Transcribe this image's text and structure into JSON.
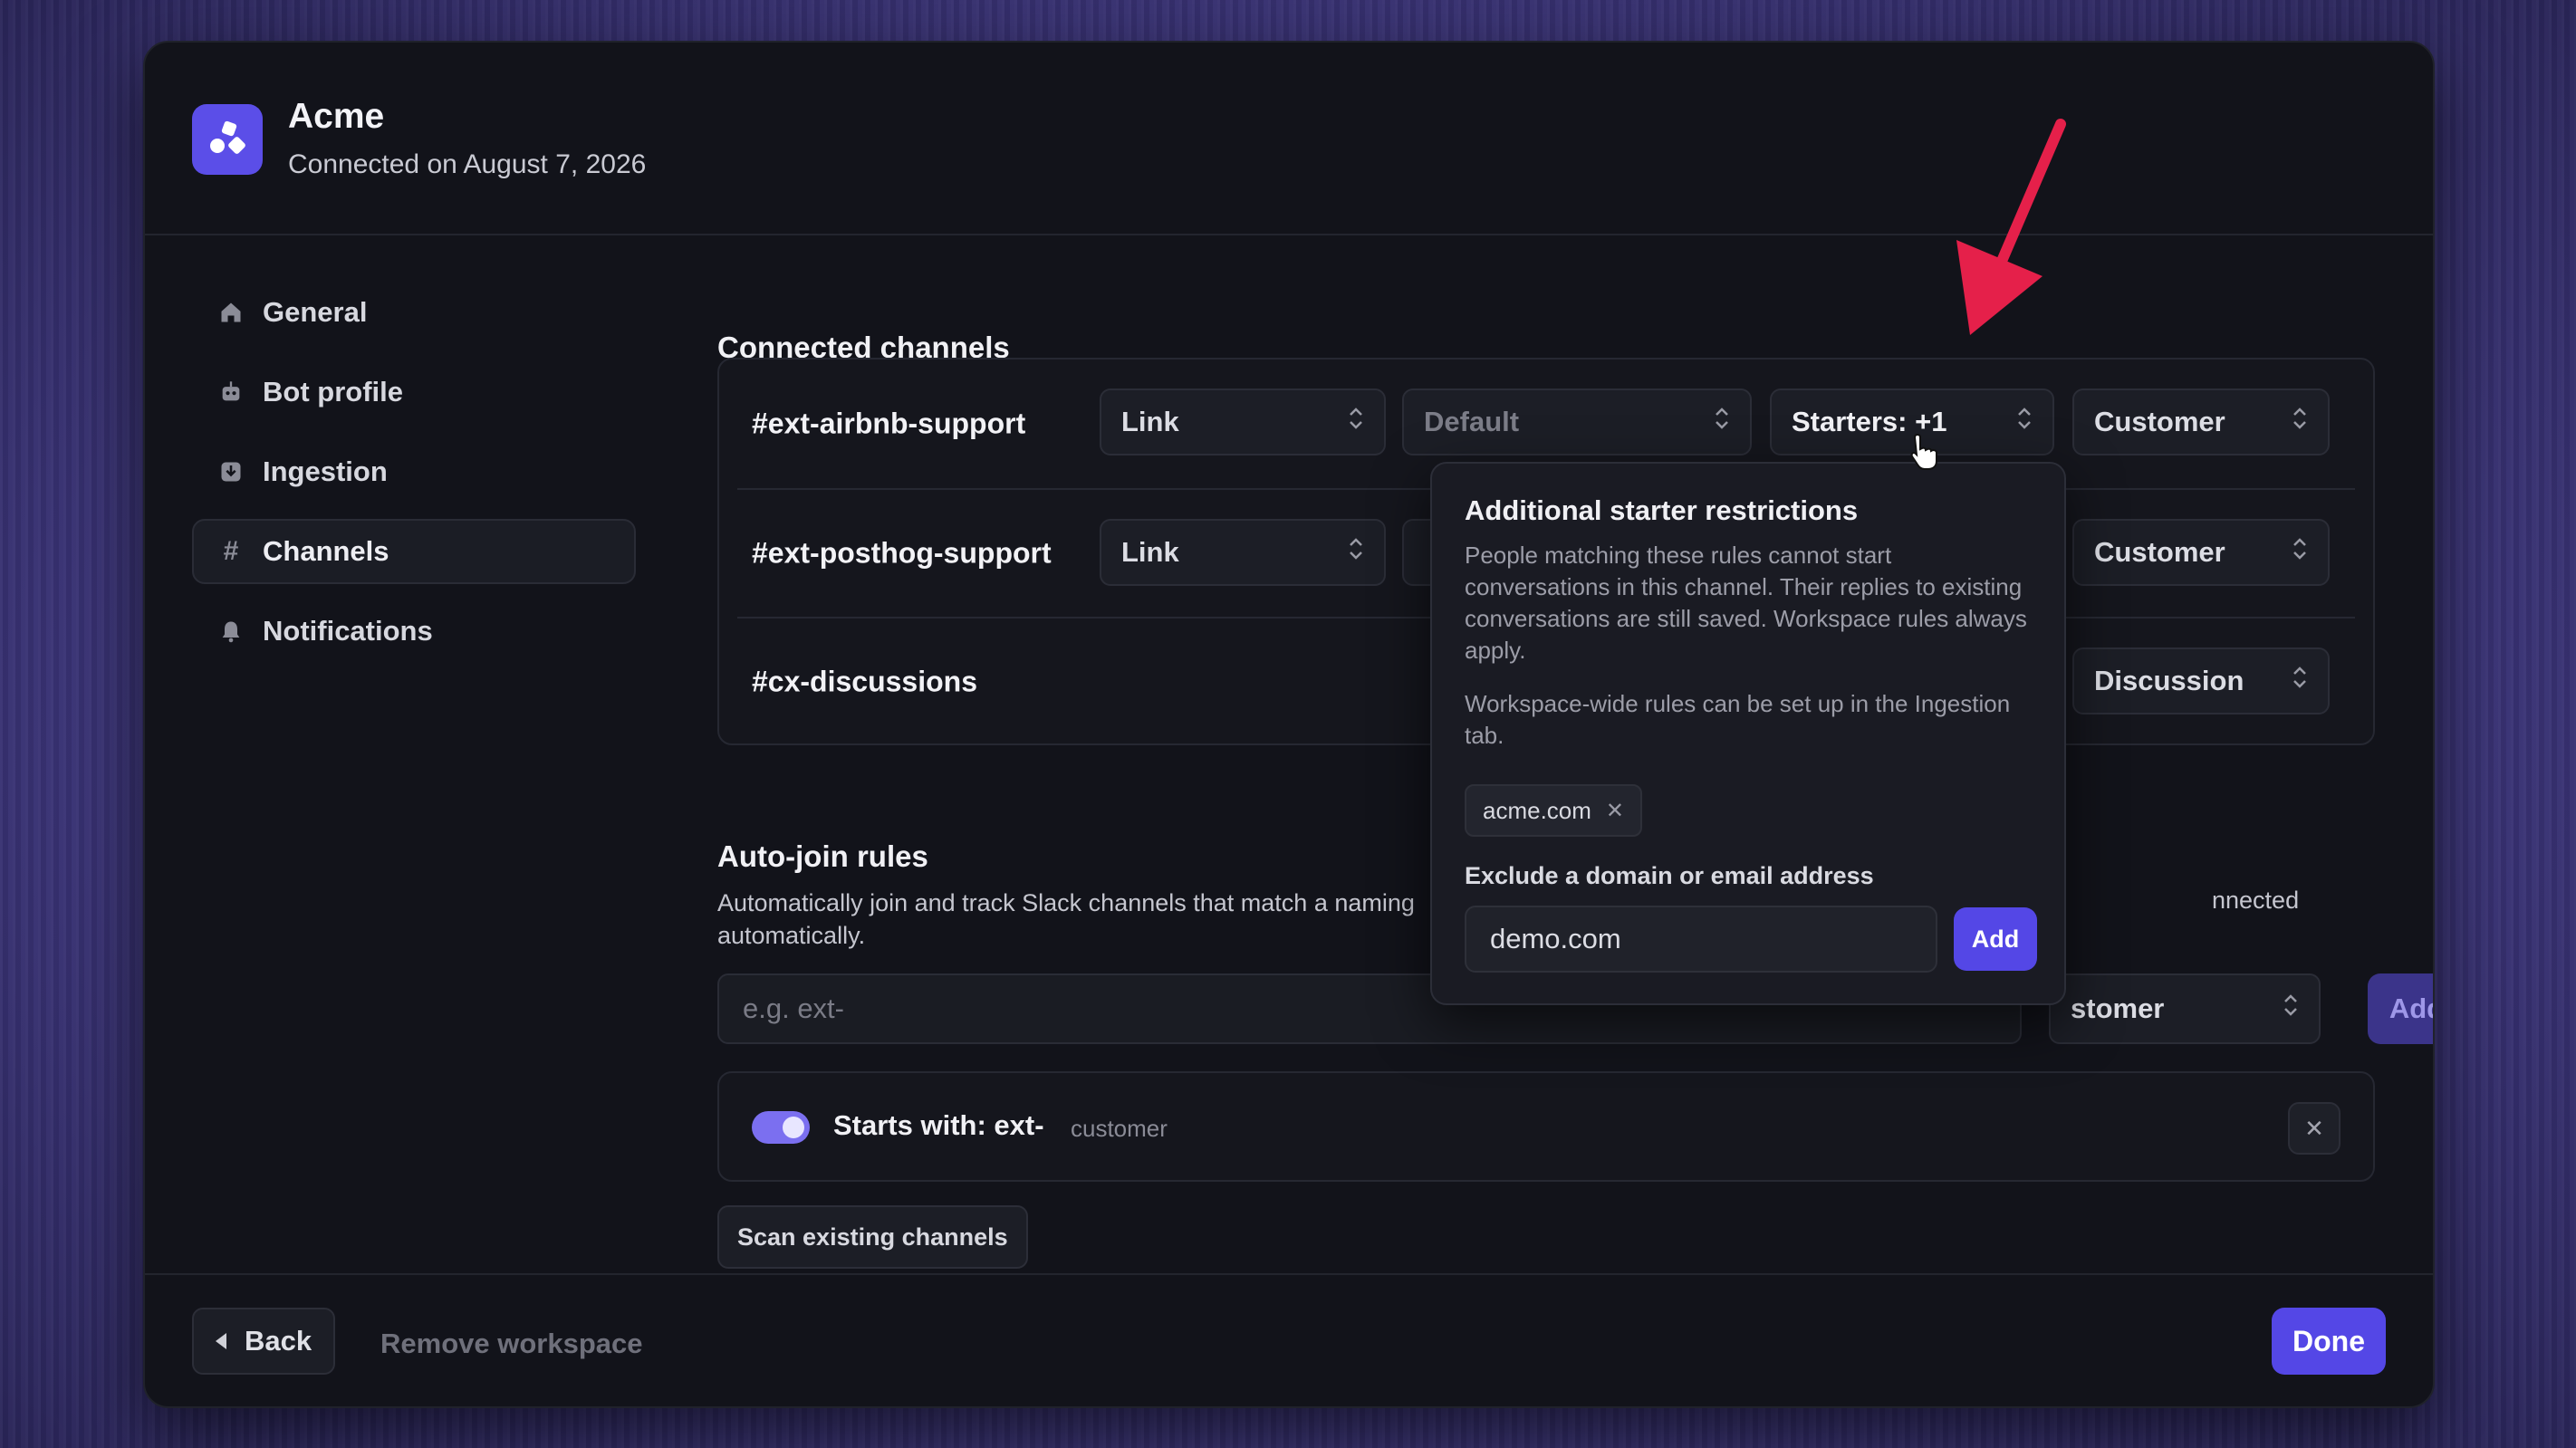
{
  "workspace": {
    "name": "Acme",
    "connected": "Connected on August 7, 2026",
    "logo_icon": "shapes-icon"
  },
  "sidebar": {
    "items": [
      {
        "label": "General",
        "icon": "home-icon"
      },
      {
        "label": "Bot profile",
        "icon": "bot-icon"
      },
      {
        "label": "Ingestion",
        "icon": "ingestion-icon"
      },
      {
        "label": "Channels",
        "icon": "hash-icon",
        "active": true
      },
      {
        "label": "Notifications",
        "icon": "bell-icon"
      }
    ]
  },
  "channels": {
    "title": "Connected channels",
    "rows": [
      {
        "name": "#ext-airbnb-support",
        "mode": "Link",
        "default": "Default",
        "starters": "Starters: +1",
        "type": "Customer"
      },
      {
        "name": "#ext-posthog-support",
        "mode": "Link",
        "type": "Customer"
      },
      {
        "name": "#cx-discussions",
        "type": "Discussion"
      }
    ]
  },
  "popover": {
    "title": "Additional starter restrictions",
    "text1": "People matching these rules cannot start conversations in this channel. Their replies to existing conversations are still saved. Workspace rules always apply.",
    "text2": "Workspace-wide rules can be set up in the Ingestion tab.",
    "chip": "acme.com",
    "input_label": "Exclude a domain or email address",
    "input_value": "demo.com",
    "add_label": "Add"
  },
  "autojoin": {
    "title": "Auto-join rules",
    "desc": "Automatically join and track Slack channels that match a naming",
    "desc_right": "nnected",
    "desc_line2": "automatically.",
    "placeholder": "e.g. ext-",
    "select_value": "stomer",
    "add_label": "Add",
    "rule": {
      "label": "Starts with: ext-",
      "tag": "customer",
      "enabled": true
    },
    "scan_label": "Scan existing channels"
  },
  "footer": {
    "back": "Back",
    "remove": "Remove workspace",
    "done": "Done"
  },
  "colors": {
    "accent": "#5447e6",
    "annotation": "#e5204a"
  }
}
